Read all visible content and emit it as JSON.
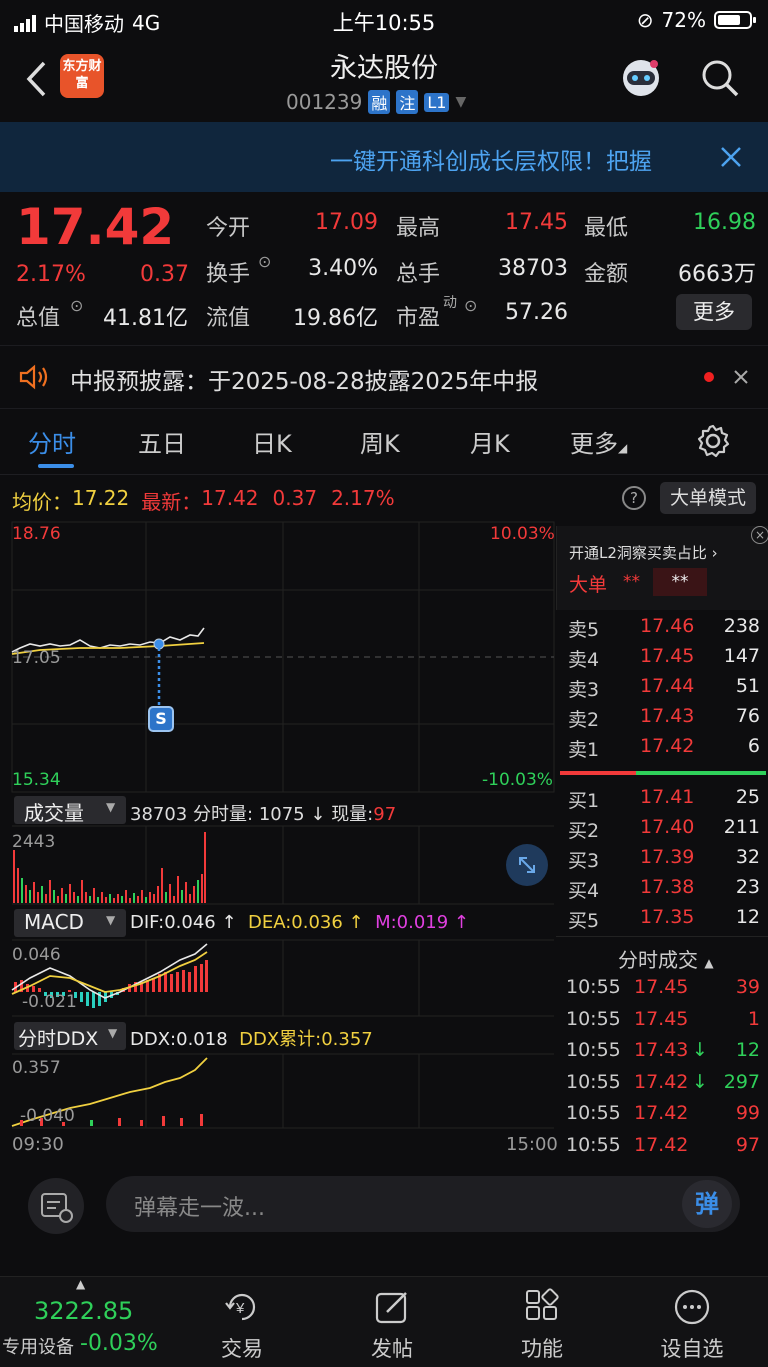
{
  "status_bar": {
    "carrier": "中国移动",
    "network": "4G",
    "time": "上午10:55",
    "battery": "72%"
  },
  "header": {
    "stock_name": "永达股份",
    "stock_code": "001239",
    "tags": [
      "融",
      "注",
      "L1"
    ],
    "logo_text": "东方财富"
  },
  "banner": {
    "text": "一键开通科创成长层权限！把握"
  },
  "quote": {
    "price": "17.42",
    "change_pct": "2.17%",
    "change": "0.37",
    "open_label": "今开",
    "open": "17.09",
    "high_label": "最高",
    "high": "17.45",
    "low_label": "最低",
    "low": "16.98",
    "turnover_label": "换手",
    "turnover": "3.40%",
    "volume_label": "总手",
    "volume": "38703",
    "amount_label": "金额",
    "amount": "6663万",
    "mcap_label": "总值",
    "mcap": "41.81亿",
    "float_label": "流值",
    "float": "19.86亿",
    "pe_label": "市盈",
    "pe_sup": "动",
    "pe": "57.26",
    "more_label": "更多"
  },
  "notice": {
    "text": "中报预披露：于2025-08-28披露2025年中报"
  },
  "tabs": [
    "分时",
    "五日",
    "日K",
    "周K",
    "月K",
    "更多"
  ],
  "subhead": {
    "avg_label": "均价：",
    "avg": "17.22",
    "latest_label": "最新：",
    "latest": "17.42",
    "latest_change": "0.37",
    "latest_pct": "2.17%",
    "mode_label": "大单模式"
  },
  "chart": {
    "price_top": "18.76",
    "price_mid": "17.05",
    "price_bottom": "15.34",
    "pct_top": "10.03%",
    "pct_bottom": "-10.03%",
    "marker": "S",
    "time_start": "09:30",
    "time_end": "15:00"
  },
  "volume_panel": {
    "label": "成交量",
    "total": "38703",
    "minute_label": "分时量:",
    "minute": "1075",
    "arrow": "↓",
    "now_label": "现量:",
    "now": "97",
    "max": "2443"
  },
  "macd_panel": {
    "label": "MACD",
    "dif": "DIF:0.046 ↑",
    "dea": "DEA:0.036 ↑",
    "m": "M:0.019 ↑",
    "top": "0.046",
    "bottom": "-0.021"
  },
  "ddx_panel": {
    "label": "分时DDX",
    "ddx": "DDX:0.018",
    "ddx_sum": "DDX累计:0.357",
    "top": "0.357",
    "bottom": "-0.040"
  },
  "order_book": {
    "promo": "开通L2洞察买卖占比",
    "big_label": "大单",
    "big_val1": "**",
    "big_val2": "**",
    "asks": [
      {
        "label": "卖5",
        "price": "17.46",
        "vol": "238"
      },
      {
        "label": "卖4",
        "price": "17.45",
        "vol": "147"
      },
      {
        "label": "卖3",
        "price": "17.44",
        "vol": "51"
      },
      {
        "label": "卖2",
        "price": "17.43",
        "vol": "76"
      },
      {
        "label": "卖1",
        "price": "17.42",
        "vol": "6"
      }
    ],
    "bids": [
      {
        "label": "买1",
        "price": "17.41",
        "vol": "25"
      },
      {
        "label": "买2",
        "price": "17.40",
        "vol": "211"
      },
      {
        "label": "买3",
        "price": "17.39",
        "vol": "32"
      },
      {
        "label": "买4",
        "price": "17.38",
        "vol": "23"
      },
      {
        "label": "买5",
        "price": "17.35",
        "vol": "12"
      }
    ],
    "trades_title": "分时成交",
    "trades": [
      {
        "time": "10:55",
        "price": "17.45",
        "dir": "",
        "vol": "39"
      },
      {
        "time": "10:55",
        "price": "17.45",
        "dir": "",
        "vol": "1"
      },
      {
        "time": "10:55",
        "price": "17.43",
        "dir": "↓",
        "vol": "12"
      },
      {
        "time": "10:55",
        "price": "17.42",
        "dir": "↓",
        "vol": "297"
      },
      {
        "time": "10:55",
        "price": "17.42",
        "dir": "",
        "vol": "99"
      },
      {
        "time": "10:55",
        "price": "17.42",
        "dir": "",
        "vol": "97"
      }
    ]
  },
  "comment_bar": {
    "placeholder": "弹幕走一波...",
    "button": "弹"
  },
  "bottom_nav": {
    "index_value": "3222.85",
    "index_label": "专用设备",
    "index_change": "-0.03%",
    "items": [
      "交易",
      "发帖",
      "功能",
      "设自选"
    ]
  },
  "colors": {
    "up": "#f23a3a",
    "down": "#2fd05a",
    "avg_line": "#f0d040",
    "banner_text": "#4da3f0"
  }
}
